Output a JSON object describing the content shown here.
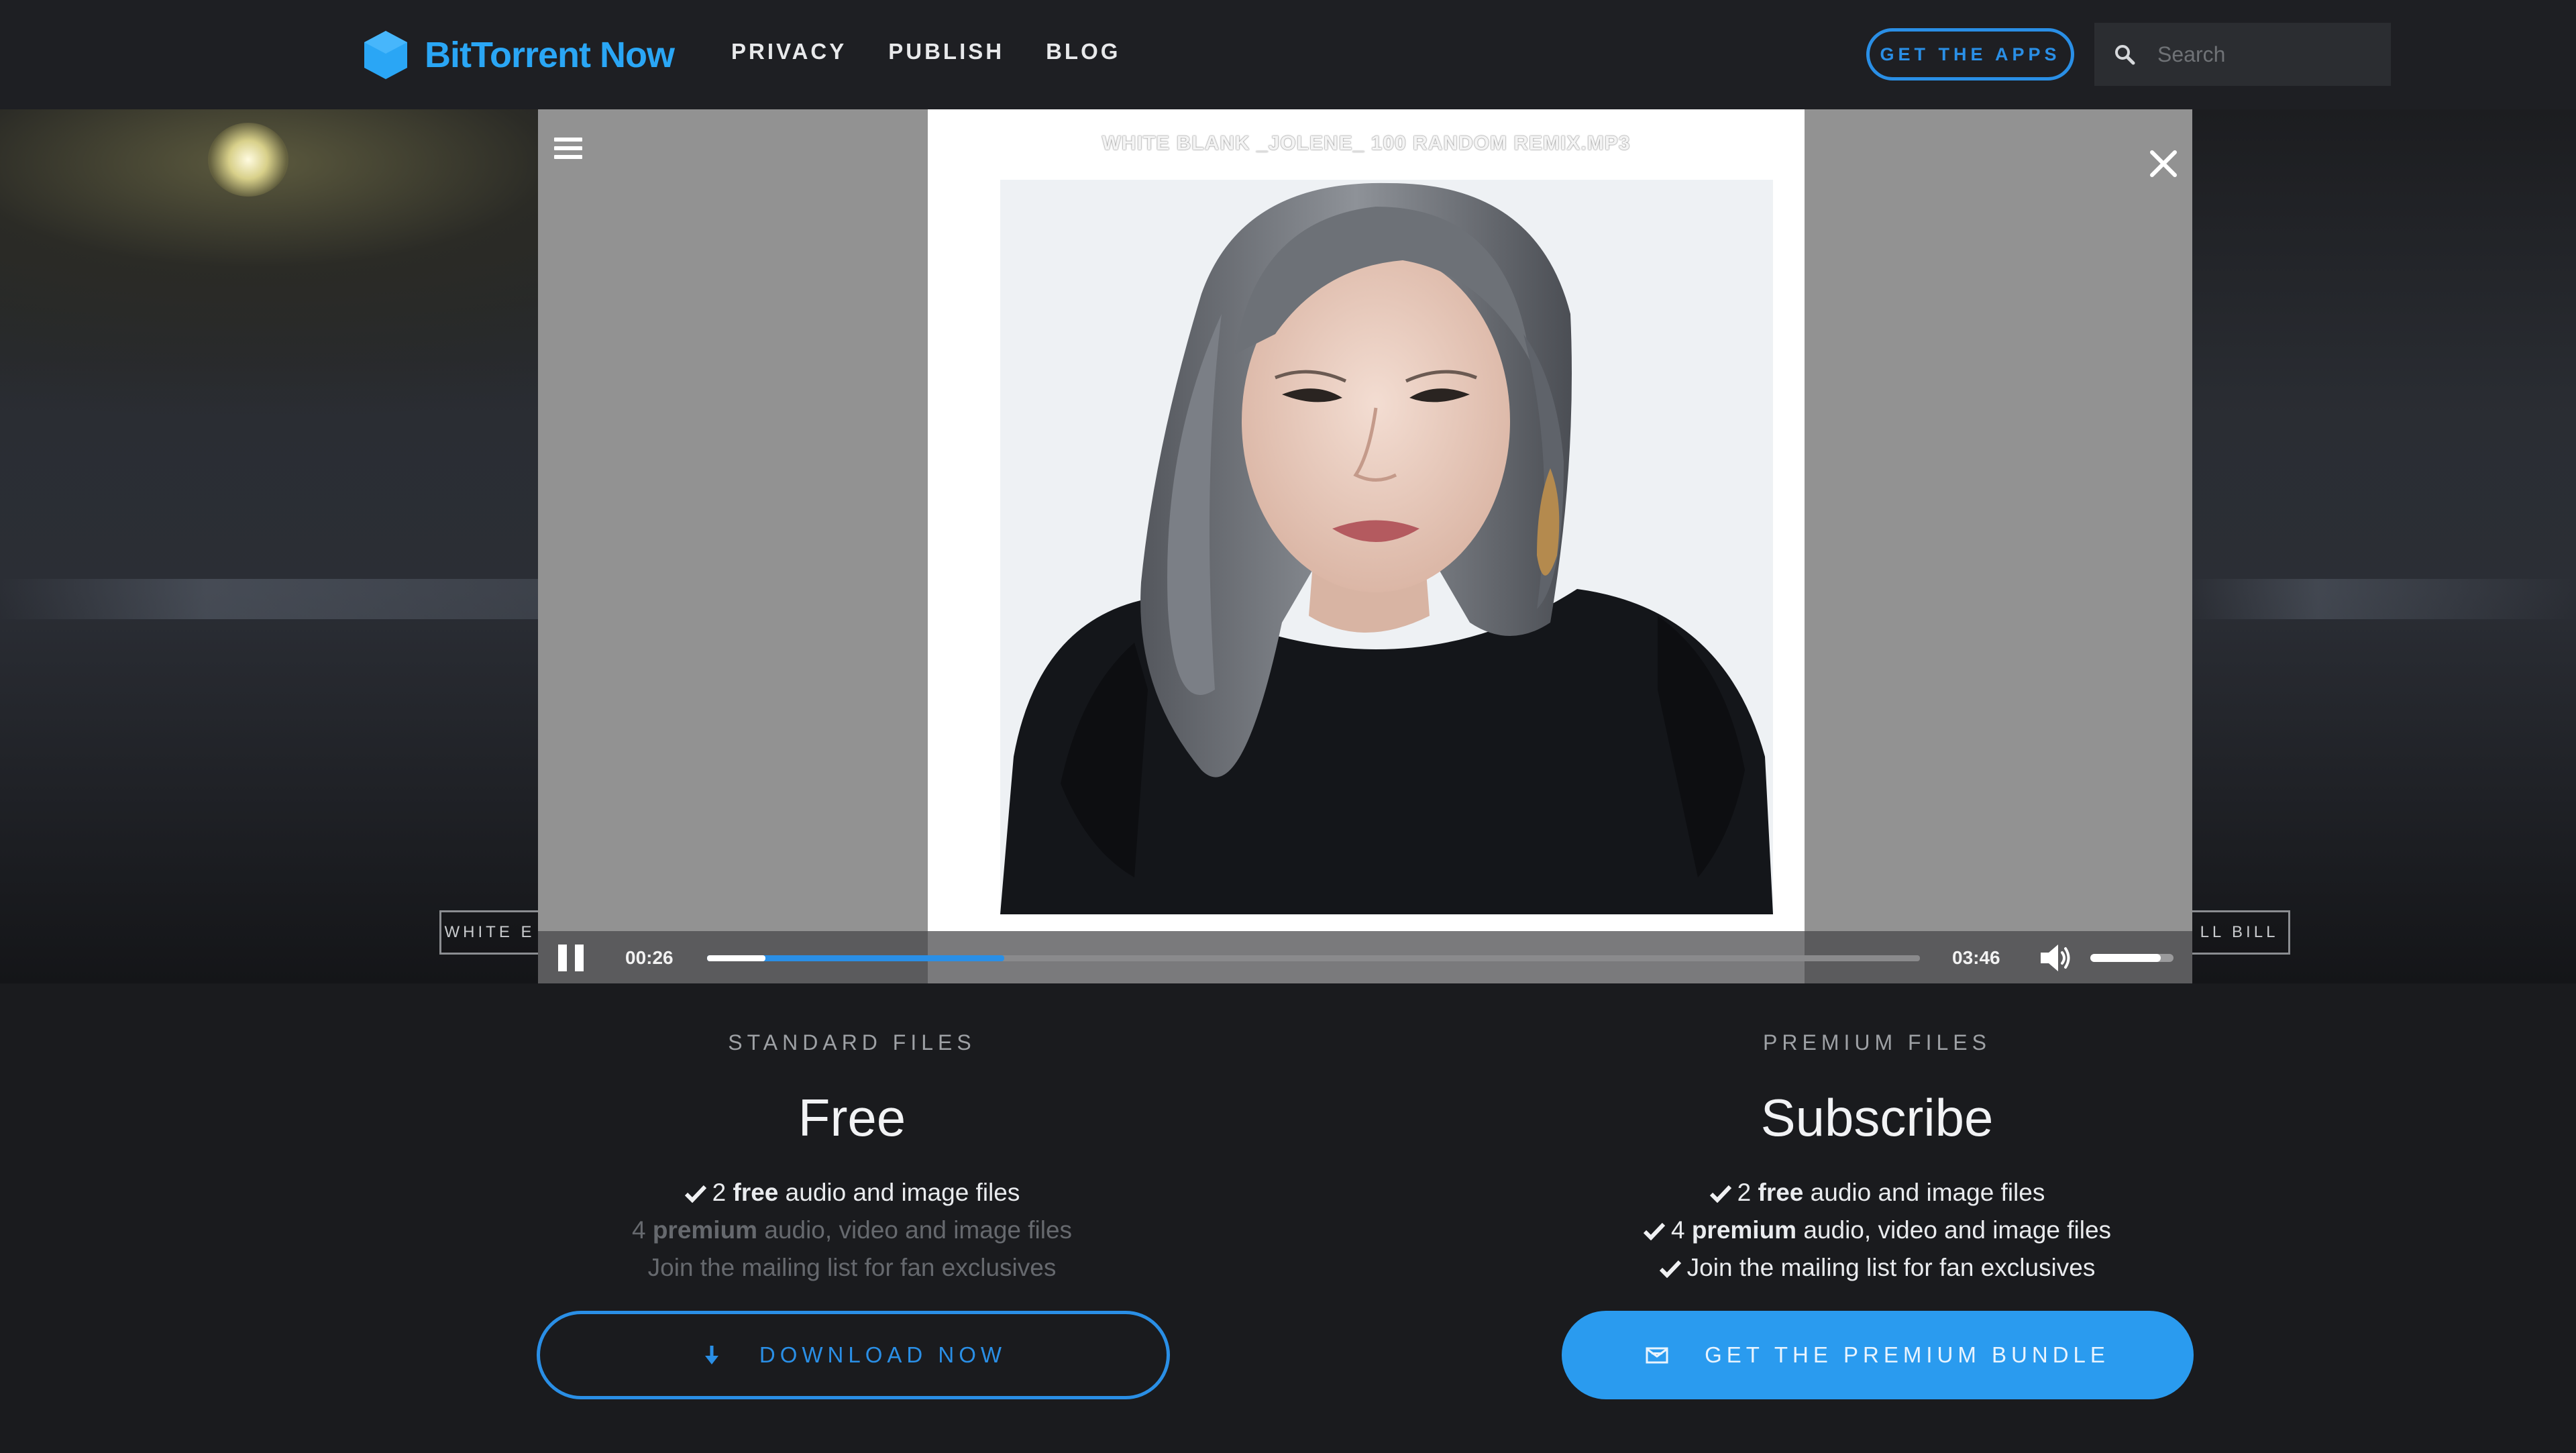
{
  "brand": {
    "name": "BitTorrent Now",
    "color": "#2aa6f5"
  },
  "nav": {
    "links": [
      "PRIVACY",
      "PUBLISH",
      "BLOG"
    ],
    "get_apps": "GET THE APPS",
    "search_placeholder": "Search"
  },
  "hero": {
    "left_button": "WHITE E",
    "right_button": "LL BILL"
  },
  "player": {
    "track_title": "WHITE BLANK _JOLENE_ 100 RANDOM REMIX.MP3",
    "current_time": "00:26",
    "total_time": "03:46",
    "progress_fraction": 0.245,
    "buffered_fraction": 0.048,
    "volume_fraction": 0.85,
    "icons": [
      "menu-icon",
      "close-icon",
      "pause-icon",
      "volume-icon"
    ]
  },
  "plans": {
    "standard": {
      "kicker": "STANDARD FILES",
      "title": "Free",
      "features": [
        {
          "pre": "2 ",
          "bold": "free",
          "post": " audio and image files",
          "included": true
        },
        {
          "pre": "4 ",
          "bold": "premium",
          "post": " audio, video and image files",
          "included": false
        },
        {
          "pre": "Join the mailing list for fan exclusives",
          "bold": "",
          "post": "",
          "included": false
        }
      ],
      "button": "DOWNLOAD NOW",
      "button_icon": "download-arrow-icon"
    },
    "premium": {
      "kicker": "PREMIUM FILES",
      "title": "Subscribe",
      "features": [
        {
          "pre": "2 ",
          "bold": "free",
          "post": " audio and image files",
          "included": true
        },
        {
          "pre": "4 ",
          "bold": "premium",
          "post": " audio, video and image files",
          "included": true
        },
        {
          "pre": "Join the mailing list for fan exclusives",
          "bold": "",
          "post": "",
          "included": true
        }
      ],
      "button": "GET THE PREMIUM BUNDLE",
      "button_icon": "envelope-icon"
    }
  },
  "colors": {
    "accent": "#2a8fe6",
    "background": "#1a1b1e",
    "navbar": "#1e1f23",
    "modal": "#929292"
  }
}
